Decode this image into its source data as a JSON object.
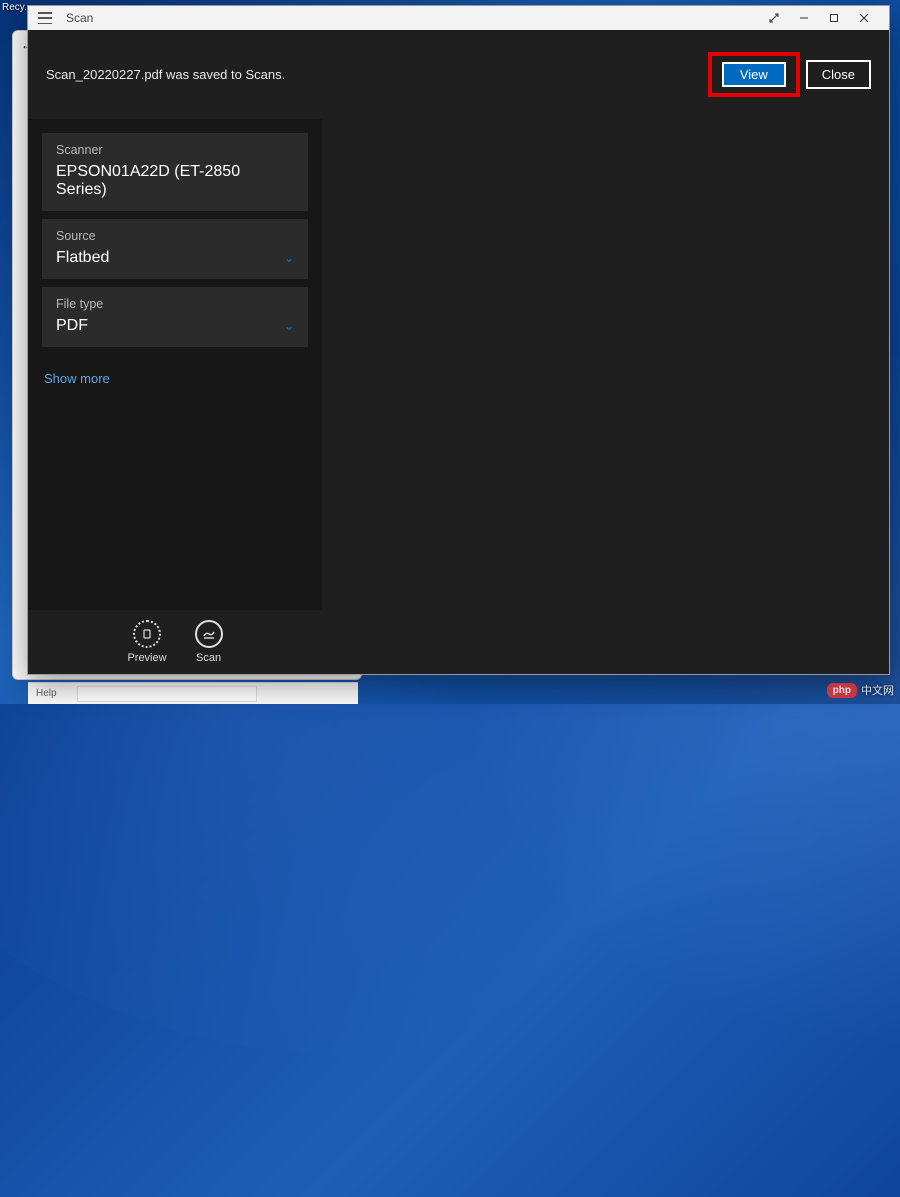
{
  "desktop": {
    "icon_label": "Recy..."
  },
  "window": {
    "title": "Scan"
  },
  "notification": {
    "message": "Scan_20220227.pdf was saved to Scans.",
    "view_label": "View",
    "close_label": "Close"
  },
  "panel": {
    "scanner": {
      "label": "Scanner",
      "value": "EPSON01A22D (ET-2850 Series)"
    },
    "source": {
      "label": "Source",
      "value": "Flatbed"
    },
    "filetype": {
      "label": "File type",
      "value": "PDF"
    },
    "show_more": "Show more"
  },
  "actions": {
    "preview": "Preview",
    "scan": "Scan"
  },
  "taskbar": {
    "help": "Help"
  },
  "watermark": {
    "badge": "php",
    "text": "中文网"
  }
}
